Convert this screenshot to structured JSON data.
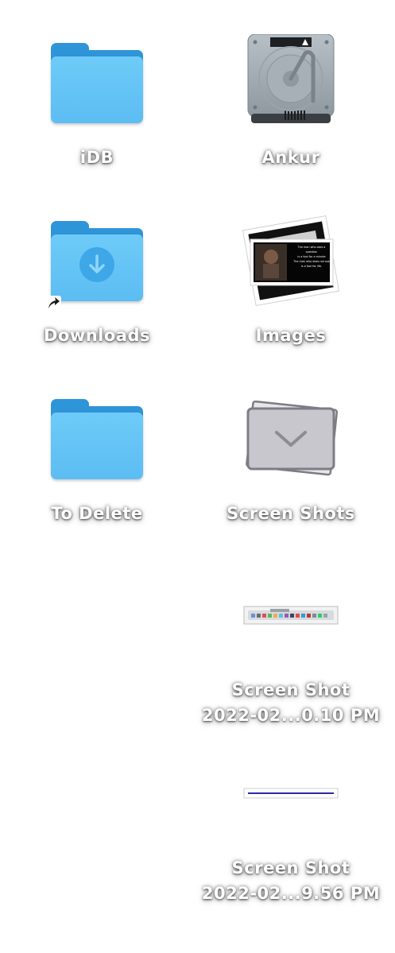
{
  "items": [
    {
      "label": "iDB",
      "icon": "folder-icon"
    },
    {
      "label": "Ankur",
      "icon": "hard-drive-icon"
    },
    {
      "label": "Downloads",
      "icon": "downloads-folder-icon"
    },
    {
      "label": "Images",
      "icon": "image-stack-icon"
    },
    {
      "label": "To Delete",
      "icon": "folder-icon"
    },
    {
      "label": "Screen Shots",
      "icon": "screenshots-folder-icon"
    },
    {
      "label_line1": "Screen Shot",
      "label_line2": "2022-02...0.10 PM",
      "icon": "screenshot-thumbnail-icon"
    },
    {
      "label_line1": "Screen Shot",
      "label_line2": "2022-02...9.56 PM",
      "icon": "screenshot-thumbnail-icon"
    }
  ],
  "photo_caption_lines": [
    "The man who asks a question",
    "is a fool for a minute",
    "The man who does not ask",
    "is a fool for life."
  ],
  "colors": {
    "folder_front": "#6ecbf8",
    "folder_back": "#2f95d9",
    "label_text": "#ffffff",
    "background": "#ffffff"
  }
}
